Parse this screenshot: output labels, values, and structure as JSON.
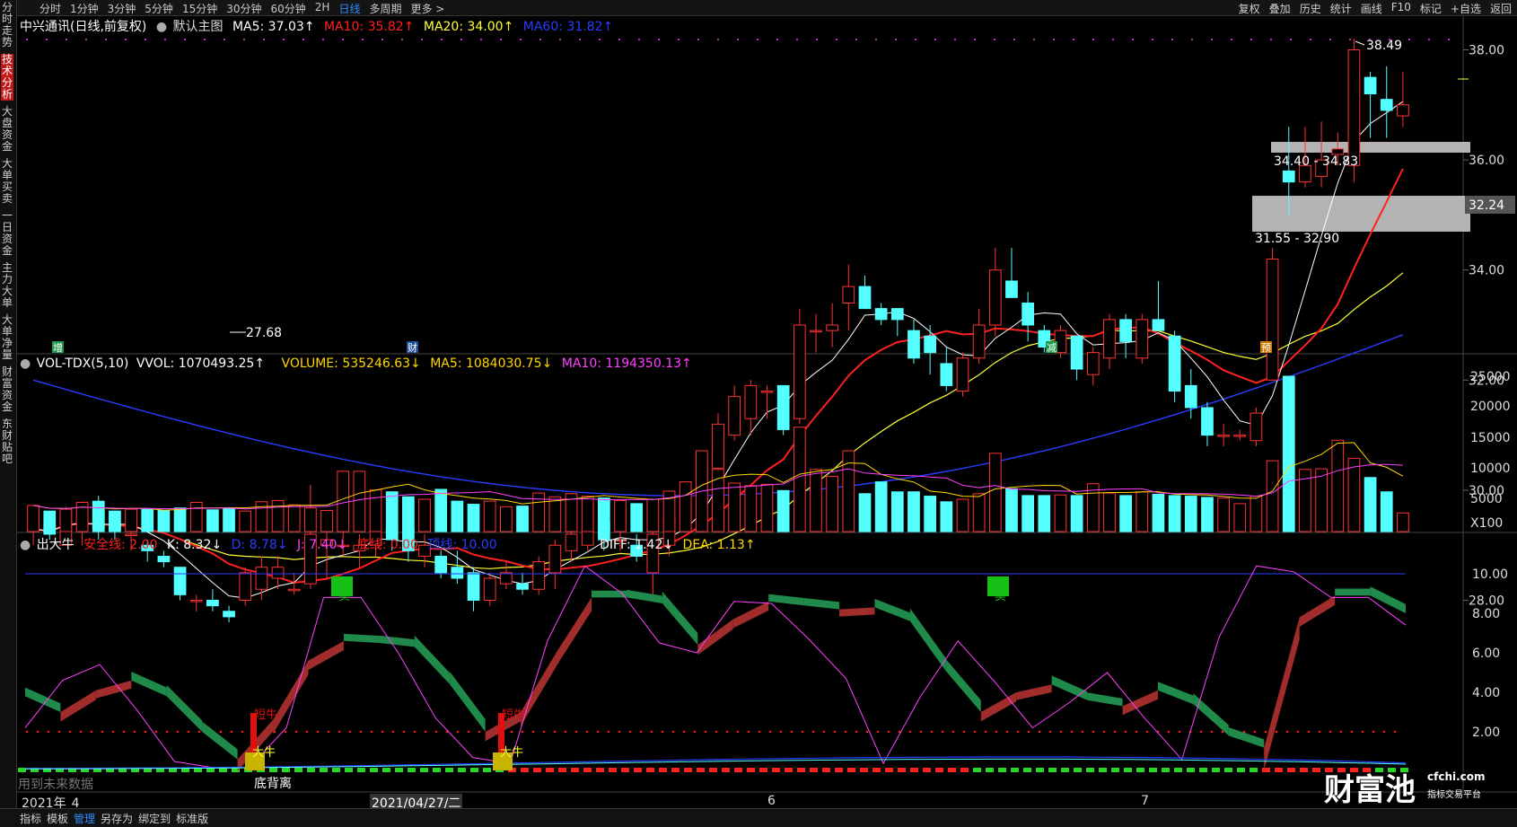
{
  "toolbar": {
    "periods": [
      "分时",
      "1分钟",
      "3分钟",
      "5分钟",
      "15分钟",
      "30分钟",
      "60分钟",
      "2H",
      "日线",
      "多周期",
      "更多 >"
    ],
    "active_period": "日线",
    "right": [
      "复权",
      "叠加",
      "历史",
      "统计",
      "画线",
      "F10",
      "标记",
      "+自选",
      "返回"
    ]
  },
  "sidebar": {
    "items": [
      "分时走势",
      "技术分析",
      "大盘资金",
      "大单买卖",
      "一日资金",
      "主力大单",
      "大单净量",
      "财富资金",
      "东财贴吧"
    ],
    "active": "技术分析"
  },
  "main_header": {
    "stock": "中兴通讯(日线,前复权)",
    "template": "默认主图",
    "ma5": "MA5: 37.03↑",
    "ma10": "MA10: 35.82↑",
    "ma20": "MA20: 34.00↑",
    "ma60": "MA60: 31.82↑"
  },
  "vol_header": {
    "name": "VOL-TDX(5,10)",
    "vvol": "VVOL: 1070493.25↑",
    "volume": "VOLUME: 535246.63↓",
    "ma5": "MA5: 1084030.75↓",
    "ma10": "MA10: 1194350.13↑"
  },
  "ind_header": {
    "name": "出大牛",
    "safe": "安全线: 2.00",
    "k": "K: 8.32↓",
    "d": "D: 8.78↓",
    "j": "J: 7.40↓",
    "bottom": "底线: 0.00",
    "top": "顶线: 10.00",
    "diff": "DIFF: 1.42↓",
    "dea": "DEA: 1.13↑"
  },
  "price_axis": [
    "38.00",
    "36.00",
    "34.00",
    "32.00",
    "30.00",
    "28.00"
  ],
  "vol_axis": [
    "25000",
    "20000",
    "15000",
    "10000",
    "5000",
    "X100"
  ],
  "ind_axis": [
    "10.00",
    "8.00",
    "6.00",
    "4.00",
    "2.00"
  ],
  "current_price_tag": "32.24",
  "annotations": {
    "high": "38.49",
    "low": "27.68",
    "zone_upper": "34.40 - 34.83",
    "zone_lower": "31.55 - 32.90",
    "markers": [
      "增",
      "财",
      "减",
      "预"
    ],
    "signals": [
      "短牛",
      "大牛",
      "底背离",
      "卖"
    ],
    "future_note": "用到未来数据"
  },
  "dates": {
    "year_label": "2021年",
    "m4": "4",
    "cursor_date": "2021/04/27/二",
    "m6": "6",
    "m7": "7"
  },
  "watermark": {
    "brand": "财富池",
    "site": "cfchi.com",
    "slogan": "指标交易平台"
  },
  "bottom_tabs": [
    "指标",
    "模板",
    "管理",
    "另存为",
    "绑定到",
    "标准版"
  ],
  "active_bottom_tab": "管理",
  "colors": {
    "up": "#ff3232",
    "down": "#54ffff",
    "ma5": "#ffffff",
    "ma10": "#ff2020",
    "ma20": "#ffff33",
    "ma60": "#2020ff",
    "magenta": "#ff40ff",
    "green": "#00b000"
  },
  "chart_data": {
    "type": "candlestick",
    "candles": [
      [
        29.3,
        29.5,
        29.0,
        29.3
      ],
      [
        29.4,
        29.6,
        29.1,
        29.2
      ],
      [
        29.0,
        29.7,
        29.0,
        29.6
      ],
      [
        29.5,
        29.8,
        29.0,
        29.5
      ],
      [
        29.8,
        29.9,
        29.1,
        29.3
      ],
      [
        29.4,
        29.6,
        29.1,
        29.3
      ],
      [
        29.2,
        29.4,
        28.9,
        29.2
      ],
      [
        29.0,
        29.1,
        28.7,
        28.9
      ],
      [
        28.8,
        28.9,
        28.6,
        28.7
      ],
      [
        28.6,
        28.6,
        28.0,
        28.1
      ],
      [
        28.0,
        28.1,
        27.8,
        28.0
      ],
      [
        28.0,
        28.2,
        27.8,
        27.9
      ],
      [
        27.8,
        27.9,
        27.6,
        27.7
      ],
      [
        28.0,
        28.6,
        27.9,
        28.5
      ],
      [
        28.2,
        28.8,
        28.0,
        28.6
      ],
      [
        28.4,
        28.8,
        28.2,
        28.6
      ],
      [
        28.2,
        28.5,
        28.1,
        28.2
      ],
      [
        28.3,
        30.1,
        28.2,
        29.2
      ],
      [
        29.0,
        29.3,
        28.4,
        29.1
      ],
      [
        29.0,
        29.3,
        28.8,
        29.0
      ],
      [
        28.9,
        29.2,
        28.6,
        29.0
      ],
      [
        29.0,
        29.4,
        28.8,
        29.3
      ],
      [
        29.3,
        29.5,
        28.9,
        29.1
      ],
      [
        29.3,
        29.8,
        28.7,
        28.9
      ],
      [
        28.8,
        29.2,
        28.6,
        29.0
      ],
      [
        28.8,
        28.9,
        28.4,
        28.5
      ],
      [
        28.6,
        28.9,
        28.3,
        28.4
      ],
      [
        28.5,
        28.6,
        27.8,
        28.0
      ],
      [
        28.0,
        28.5,
        27.9,
        28.4
      ],
      [
        28.3,
        28.7,
        28.2,
        28.5
      ],
      [
        28.3,
        28.5,
        28.1,
        28.2
      ],
      [
        28.2,
        28.8,
        28.1,
        28.7
      ],
      [
        28.5,
        29.1,
        28.2,
        29.0
      ],
      [
        28.9,
        29.4,
        28.7,
        29.2
      ],
      [
        29.0,
        29.4,
        28.9,
        29.3
      ],
      [
        29.4,
        29.5,
        28.9,
        29.1
      ],
      [
        29.1,
        29.3,
        28.9,
        29.1
      ],
      [
        29.0,
        29.2,
        28.7,
        28.8
      ],
      [
        28.5,
        29.3,
        28.1,
        29.2
      ],
      [
        29.0,
        29.6,
        28.8,
        29.5
      ],
      [
        29.5,
        30.0,
        29.3,
        29.9
      ],
      [
        29.8,
        30.6,
        29.7,
        30.5
      ],
      [
        30.4,
        31.4,
        30.3,
        31.2
      ],
      [
        31.0,
        31.9,
        30.9,
        31.7
      ],
      [
        31.3,
        32.0,
        31.0,
        31.9
      ],
      [
        31.8,
        31.9,
        31.3,
        31.8
      ],
      [
        31.9,
        31.9,
        31.0,
        31.1
      ],
      [
        31.3,
        33.3,
        31.2,
        33.0
      ],
      [
        32.9,
        33.2,
        32.5,
        32.9
      ],
      [
        32.9,
        33.4,
        32.6,
        33.0
      ],
      [
        33.4,
        34.1,
        32.9,
        33.7
      ],
      [
        33.7,
        33.9,
        33.3,
        33.3
      ],
      [
        33.3,
        33.4,
        33.0,
        33.1
      ],
      [
        33.3,
        33.3,
        32.8,
        33.1
      ],
      [
        32.9,
        33.1,
        32.3,
        32.4
      ],
      [
        32.8,
        33.0,
        32.1,
        32.5
      ],
      [
        32.3,
        32.6,
        31.8,
        31.9
      ],
      [
        31.8,
        32.5,
        31.7,
        32.4
      ],
      [
        32.4,
        33.3,
        32.3,
        33.0
      ],
      [
        33.0,
        34.4,
        32.8,
        34.0
      ],
      [
        33.8,
        34.4,
        33.5,
        33.5
      ],
      [
        33.4,
        33.6,
        32.7,
        33.0
      ],
      [
        32.9,
        33.0,
        32.5,
        32.6
      ],
      [
        32.5,
        33.0,
        32.4,
        32.9
      ],
      [
        32.8,
        32.8,
        32.0,
        32.2
      ],
      [
        32.1,
        32.6,
        31.9,
        32.5
      ],
      [
        32.4,
        33.2,
        32.2,
        33.1
      ],
      [
        33.1,
        33.2,
        32.4,
        32.7
      ],
      [
        32.4,
        33.2,
        32.3,
        33.1
      ],
      [
        33.1,
        33.8,
        32.9,
        32.9
      ],
      [
        32.8,
        32.9,
        31.6,
        31.8
      ],
      [
        31.9,
        32.2,
        31.3,
        31.5
      ],
      [
        31.5,
        31.6,
        30.8,
        31.0
      ],
      [
        31.0,
        31.2,
        30.8,
        31.0
      ],
      [
        31.0,
        31.1,
        30.9,
        31.0
      ],
      [
        30.9,
        31.5,
        30.8,
        31.4
      ],
      [
        32.0,
        34.4,
        32.0,
        34.2
      ],
      [
        35.8,
        36.6,
        35.0,
        35.6
      ],
      [
        35.6,
        36.6,
        35.5,
        35.9
      ],
      [
        35.7,
        36.7,
        35.5,
        36.0
      ],
      [
        36.1,
        36.5,
        35.9,
        36.2
      ],
      [
        35.9,
        38.2,
        35.6,
        38.0
      ],
      [
        37.5,
        37.6,
        36.4,
        37.2
      ],
      [
        37.1,
        37.7,
        36.4,
        36.9
      ],
      [
        36.8,
        37.6,
        36.6,
        37.0
      ]
    ],
    "volume_x100": [
      4200,
      3300,
      3600,
      4700,
      3400,
      3300,
      3600,
      3600,
      3400,
      3800,
      4700,
      3500,
      3800,
      3300,
      4800,
      5000,
      4300,
      3800,
      3400,
      9700,
      9700,
      6700,
      6400,
      5600,
      5200,
      6800,
      4900,
      4400,
      4900,
      4000,
      4100,
      6200,
      5600,
      6100,
      5700,
      5400,
      5000,
      4500,
      5200,
      6500,
      8000,
      13000,
      10000,
      7800,
      7400,
      7600,
      6600,
      16800,
      10000,
      8900,
      13000,
      6100,
      8000,
      6400,
      6400,
      5700,
      4800,
      5200,
      6100,
      12600,
      6900,
      5800,
      5800,
      5900,
      5800,
      7700,
      6200,
      5800,
      6400,
      6000,
      5800,
      5700,
      5500,
      5400,
      4500,
      5700,
      11400,
      25000,
      10000,
      10100,
      14700,
      11800,
      8700,
      6400,
      3000
    ]
  }
}
